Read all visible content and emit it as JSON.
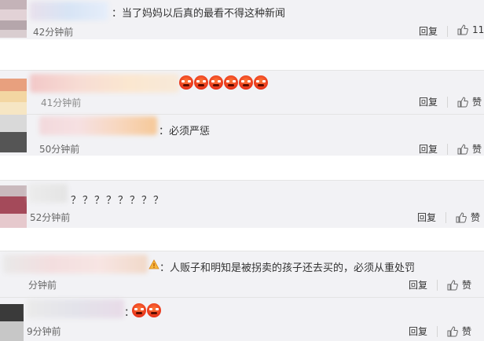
{
  "comments": [
    {
      "text": "：当了妈妈以后真的最看不得这种新闻",
      "time": "42分钟前",
      "reply": "回复",
      "like": "11"
    },
    {
      "text": "",
      "emoji_count": 6,
      "time": "41分钟前",
      "reply": "回复",
      "like": "赞"
    },
    {
      "text": "：必须严惩",
      "time": "50分钟前",
      "reply": "回复",
      "like": "赞"
    },
    {
      "text": "？？？？？？？？",
      "time": "52分钟前",
      "reply": "回复",
      "like": "赞"
    },
    {
      "text": "：人贩子和明知是被拐卖的孩子还去买的，必须从重处罚",
      "time": "分钟前",
      "reply": "回复",
      "like": "赞"
    },
    {
      "text": "：",
      "emoji_count": 2,
      "time": "9分钟前",
      "reply": "回复",
      "like": "赞"
    }
  ],
  "colors": {
    "bg_band": "#f2f2f5",
    "text": "#333333",
    "time": "#666666",
    "emoji": "#e8321a"
  },
  "icons": {
    "like": "thumbs-up-icon",
    "warning": "warning-icon",
    "emoji": "angry-face-icon"
  }
}
